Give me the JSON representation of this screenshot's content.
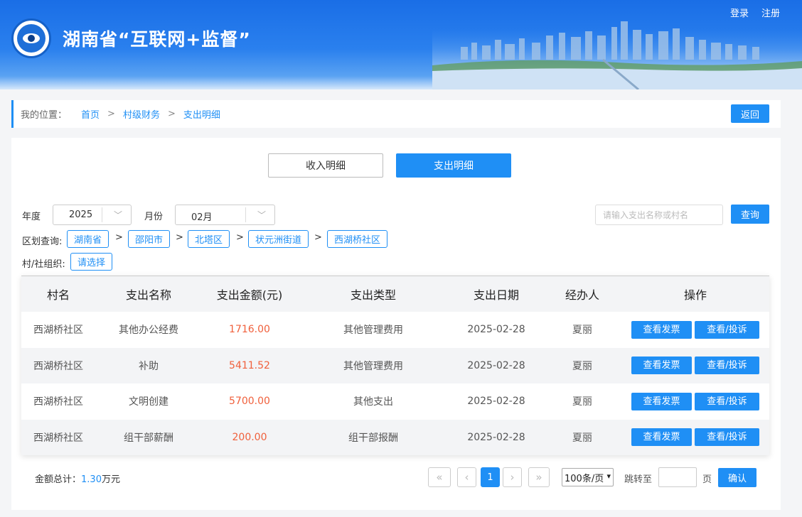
{
  "header": {
    "title": "湖南省“互联网+监督”",
    "login": "登录",
    "register": "注册"
  },
  "breadcrumb": {
    "label": "我的位置：",
    "items": [
      "首页",
      "村级财务",
      "支出明细"
    ],
    "separator": ">",
    "back": "返回"
  },
  "tabs": {
    "income": "收入明细",
    "expense": "支出明细"
  },
  "filters": {
    "year_label": "年度",
    "year_value": "2025",
    "month_label": "月份",
    "month_value": "02月",
    "search_placeholder": "请输入支出名称或村名",
    "query_button": "查询",
    "region_label": "区划查询:",
    "region_path": [
      "湖南省",
      "邵阳市",
      "北塔区",
      "状元洲街道",
      "西湖桥社区"
    ],
    "region_separator": ">",
    "org_label": "村/社组织:",
    "org_select": "请选择"
  },
  "table": {
    "headers": [
      "村名",
      "支出名称",
      "支出金额(元)",
      "支出类型",
      "支出日期",
      "经办人",
      "操作"
    ],
    "rows": [
      {
        "village": "西湖桥社区",
        "name": "其他办公经费",
        "amount": "1716.00",
        "type": "其他管理费用",
        "date": "2025-02-28",
        "handler": "夏丽"
      },
      {
        "village": "西湖桥社区",
        "name": "补助",
        "amount": "5411.52",
        "type": "其他管理费用",
        "date": "2025-02-28",
        "handler": "夏丽"
      },
      {
        "village": "西湖桥社区",
        "name": "文明创建",
        "amount": "5700.00",
        "type": "其他支出",
        "date": "2025-02-28",
        "handler": "夏丽"
      },
      {
        "village": "西湖桥社区",
        "name": "组干部薪酬",
        "amount": "200.00",
        "type": "组干部报酬",
        "date": "2025-02-28",
        "handler": "夏丽"
      }
    ],
    "op_invoice": "查看发票",
    "op_complaint": "查看/投诉"
  },
  "footer": {
    "total_label": "金额总计：",
    "total_value": "1.30",
    "total_unit": "万元",
    "current_page": "1",
    "page_size": "100条/页",
    "jump_label": "跳转至",
    "page_unit": "页",
    "confirm": "确认"
  },
  "icons": {
    "first": "«",
    "prev": "‹",
    "next": "›",
    "last": "»",
    "dropdown": "chevron-down-icon"
  },
  "colors": {
    "accent": "#1f8ff5",
    "amount": "#f0603c",
    "header_blue": "#1a6ee6"
  }
}
